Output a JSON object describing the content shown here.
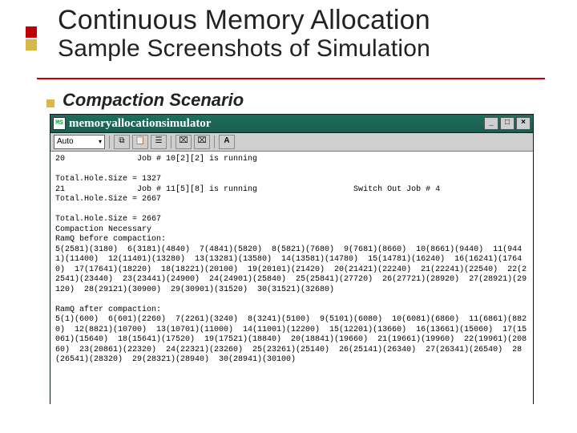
{
  "title_main": "Continuous Memory Allocation",
  "title_sub": "Sample Screenshots of Simulation",
  "scenario_label": "Compaction Scenario",
  "window": {
    "icon_label": "MS",
    "title": "memoryallocationsimulator",
    "btn_min": "_",
    "btn_max": "□",
    "btn_close": "×"
  },
  "toolbar": {
    "combo_value": "Auto",
    "combo_caret": "▾",
    "copy_icon": "⧉",
    "paste_icon": "📋",
    "props_icon": "☰",
    "view1_icon": "⌧",
    "view2_icon": "⌧",
    "font_icon": "A"
  },
  "terminal_text": "20               Job # 10[2][2] is running\n\nTotal.Hole.Size = 1327\n21               Job # 11[5][8] is running                    Switch Out Job # 4\nTotal.Hole.Size = 2667\n\nTotal.Hole.Size = 2667\nCompaction Necessary\nRamQ before compaction:\n5(2581)(3180)  6(3181)(4840)  7(4841)(5820)  8(5821)(7680)  9(7681)(8660)  10(8661)(9440)  11(9441)(11400)  12(11401)(13280)  13(13281)(13580)  14(13581)(14780)  15(14781)(16240)  16(16241)(17640)  17(17641)(18220)  18(18221)(20100)  19(20101)(21420)  20(21421)(22240)  21(22241)(22540)  22(22541)(23440)  23(23441)(24900)  24(24901)(25840)  25(25841)(27720)  26(27721)(28920)  27(28921)(29120)  28(29121)(30900)  29(30901)(31520)  30(31521)(32680)\n\nRamQ after compaction:\n5(1)(600)  6(601)(2260)  7(2261)(3240)  8(3241)(5100)  9(5101)(6080)  10(6081)(6860)  11(6861)(8820)  12(8821)(10700)  13(10701)(11000)  14(11001)(12200)  15(12201)(13660)  16(13661)(15060)  17(15061)(15640)  18(15641)(17520)  19(17521)(18840)  20(18841)(19660)  21(19661)(19960)  22(19961)(20860)  23(20861)(22320)  24(22321)(23260)  25(23261)(25140)  26(25141)(26340)  27(26341)(26540)  28(26541)(28320)  29(28321)(28940)  30(28941)(30100)"
}
